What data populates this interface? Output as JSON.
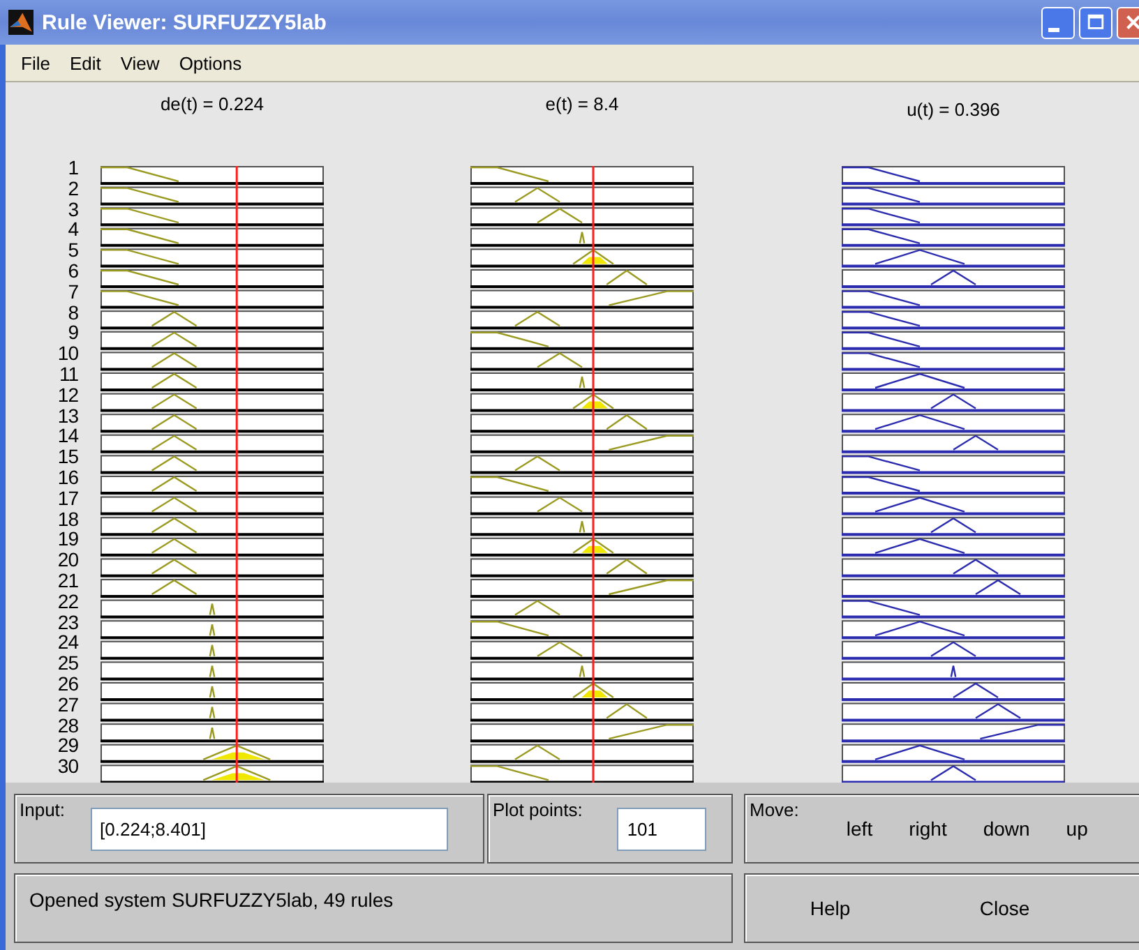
{
  "window": {
    "title": "Rule Viewer: SURFUZZY5lab"
  },
  "menu": [
    "File",
    "Edit",
    "View",
    "Options"
  ],
  "rule_numbers": [
    "1",
    "2",
    "3",
    "4",
    "5",
    "6",
    "7",
    "8",
    "9",
    "10",
    "11",
    "12",
    "13",
    "14",
    "15",
    "16",
    "17",
    "18",
    "19",
    "20",
    "21",
    "22",
    "23",
    "24",
    "25",
    "26",
    "27",
    "28",
    "29",
    "30"
  ],
  "variables": [
    {
      "label": "de(t) = 0.224",
      "kind": "input"
    },
    {
      "label": "e(t) = 8.4",
      "kind": "input"
    },
    {
      "label": "u(t) = 0.396",
      "kind": "output"
    }
  ],
  "input_panel": {
    "label": "Input:",
    "value": "[0.224;8.401]"
  },
  "plot_points": {
    "label": "Plot points:",
    "value": "101"
  },
  "move": {
    "label": "Move:",
    "buttons": [
      "left",
      "right",
      "down",
      "up"
    ]
  },
  "status": "Opened system SURFUZZY5lab, 49 rules",
  "buttons": [
    "Help",
    "Close"
  ]
}
